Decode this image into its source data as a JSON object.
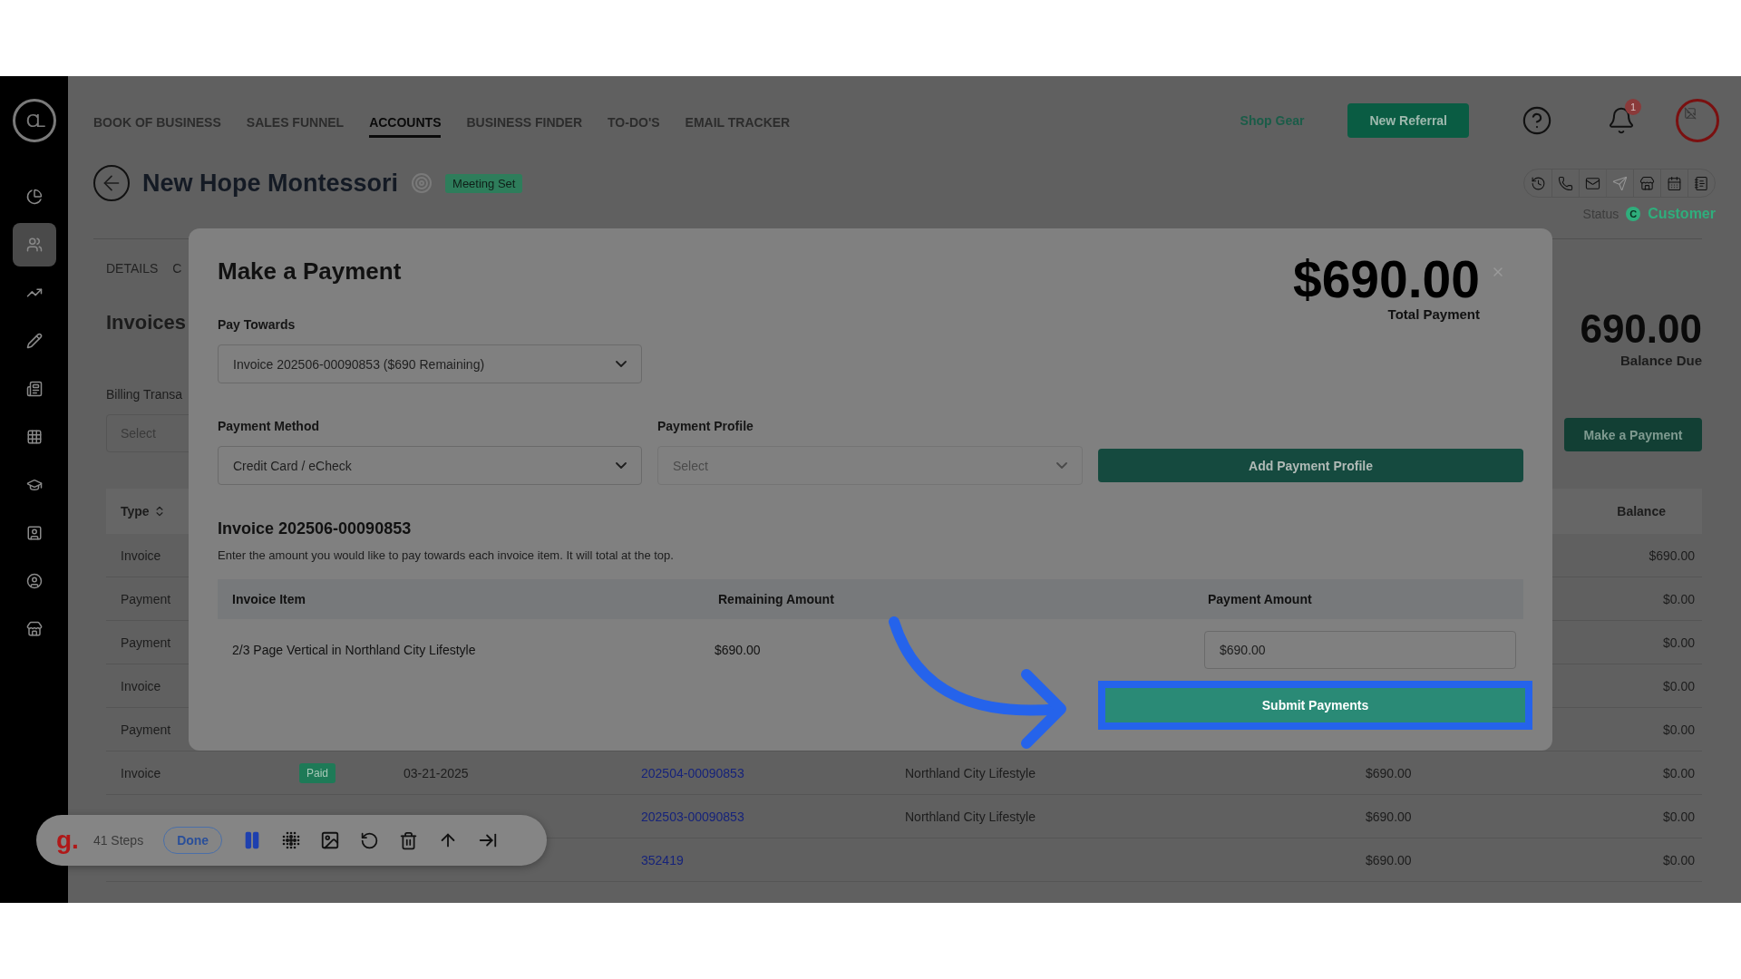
{
  "brand": {
    "mark": "CL"
  },
  "sidebar": {
    "items": [
      {
        "selected": false
      },
      {
        "selected": true
      },
      {
        "selected": false
      },
      {
        "selected": false
      },
      {
        "selected": false
      },
      {
        "selected": false
      },
      {
        "selected": false
      },
      {
        "selected": false
      },
      {
        "selected": false
      },
      {
        "selected": false
      }
    ]
  },
  "nav": {
    "tabs": [
      {
        "label": "BOOK OF BUSINESS",
        "selected": false
      },
      {
        "label": "SALES FUNNEL",
        "selected": false
      },
      {
        "label": "ACCOUNTS",
        "selected": true
      },
      {
        "label": "BUSINESS FINDER",
        "selected": false
      },
      {
        "label": "TO-DO'S",
        "selected": false
      },
      {
        "label": "EMAIL TRACKER",
        "selected": false
      }
    ],
    "shop_link": "Shop Gear",
    "referral_button": "New Referral",
    "notification_count": "1"
  },
  "account": {
    "name": "New Hope Montessori",
    "badge": "Meeting Set",
    "status_label": "Status",
    "status_icon": "C",
    "status": "Customer",
    "actions": [
      {
        "disabled": false
      },
      {
        "disabled": false
      },
      {
        "disabled": false
      },
      {
        "disabled": true
      },
      {
        "disabled": false
      },
      {
        "disabled": false
      },
      {
        "disabled": false
      }
    ]
  },
  "detail_tabs": [
    {
      "label": "DETAILS"
    },
    {
      "label": "C"
    }
  ],
  "invoices": {
    "title": "Invoices",
    "billing_label": "Billing Transa",
    "billing_placeholder": "Select",
    "balance": "690.00",
    "balance_label": "Balance Due",
    "pay_button": "Make a Payment",
    "columns": [
      {
        "label": "Type",
        "sortable": true
      },
      {
        "label": "Balance",
        "sortable": false
      }
    ],
    "rows": [
      {
        "type": "Invoice",
        "balance": "$690.00"
      },
      {
        "type": "Payment",
        "balance": "$0.00"
      },
      {
        "type": "Payment",
        "balance": "$0.00"
      },
      {
        "type": "Invoice",
        "balance": "$0.00"
      },
      {
        "type": "Payment",
        "balance": "$0.00"
      },
      {
        "type": "Invoice",
        "status": "Paid",
        "date": "03-21-2025",
        "number": "202504-00090853",
        "publication": "Northland City Lifestyle",
        "amount": "$690.00",
        "balance": "$0.00"
      },
      {
        "number": "202503-00090853",
        "publication": "Northland City Lifestyle",
        "amount": "$690.00",
        "balance": "$0.00"
      },
      {
        "number": "352419",
        "amount": "$690.00",
        "balance": "$0.00"
      }
    ]
  },
  "modal": {
    "title": "Make a Payment",
    "total": "$690.00",
    "total_label": "Total Payment",
    "pay_towards": {
      "label": "Pay Towards",
      "value": "Invoice 202506-00090853 ($690 Remaining)"
    },
    "payment_method": {
      "label": "Payment Method",
      "value": "Credit Card / eCheck"
    },
    "payment_profile": {
      "label": "Payment Profile",
      "placeholder": "Select",
      "disabled": true
    },
    "add_profile_button": "Add Payment Profile",
    "invoice_title": "Invoice 202506-00090853",
    "description": "Enter the amount you would like to pay towards each invoice item. It will total at the top.",
    "columns": [
      "Invoice Item",
      "Remaining Amount",
      "Payment Amount"
    ],
    "items": [
      {
        "name": "2/3 Page Vertical in Northland City Lifestyle",
        "remaining": "$690.00",
        "payment": "$690.00"
      }
    ],
    "submit_button": "Submit Payments"
  },
  "recorder": {
    "logo": "g.",
    "steps": "41 Steps",
    "done_button": "Done"
  }
}
